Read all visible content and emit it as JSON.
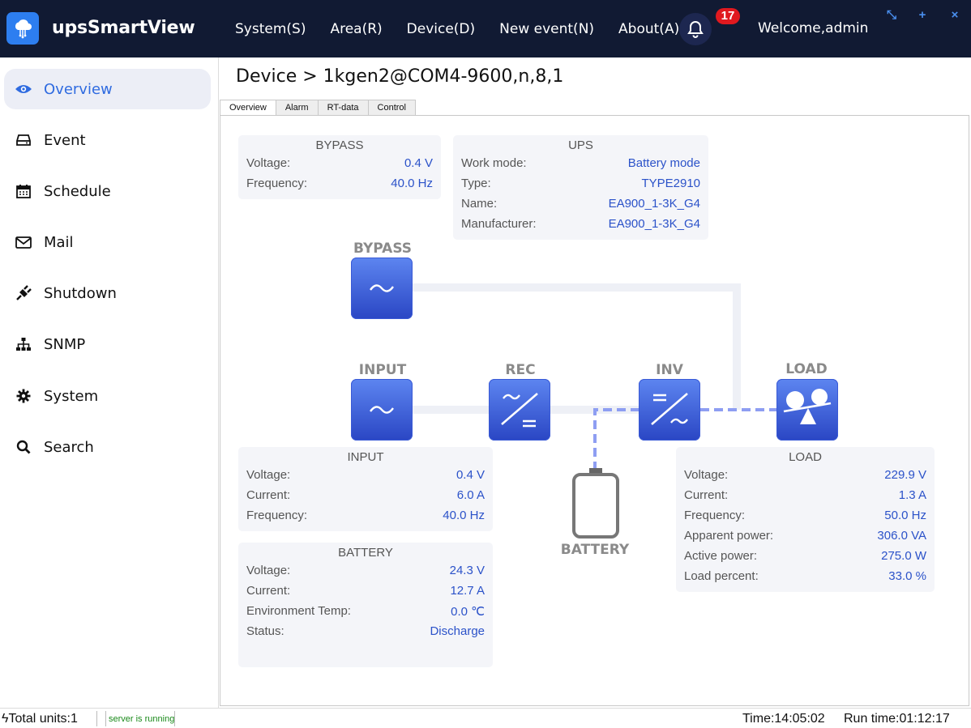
{
  "app": {
    "title": "upsSmartView"
  },
  "menu": [
    {
      "label": "System(S)"
    },
    {
      "label": "Area(R)"
    },
    {
      "label": "Device(D)"
    },
    {
      "label": "New event(N)"
    },
    {
      "label": "About(A)"
    }
  ],
  "header": {
    "notification_count": "17",
    "welcome": "Welcome,admin"
  },
  "sidebar": {
    "items": [
      {
        "label": "Overview",
        "icon": "eye-icon"
      },
      {
        "label": "Event",
        "icon": "drive-icon"
      },
      {
        "label": "Schedule",
        "icon": "calendar-icon"
      },
      {
        "label": "Mail",
        "icon": "mail-icon"
      },
      {
        "label": "Shutdown",
        "icon": "plug-icon"
      },
      {
        "label": "SNMP",
        "icon": "network-icon"
      },
      {
        "label": "System",
        "icon": "gear-icon"
      },
      {
        "label": "Search",
        "icon": "search-icon"
      }
    ]
  },
  "breadcrumb": "Device > 1kgen2@COM4-9600,n,8,1",
  "tabs": [
    {
      "label": "Overview"
    },
    {
      "label": "Alarm"
    },
    {
      "label": "RT-data"
    },
    {
      "label": "Control"
    }
  ],
  "panels": {
    "bypass": {
      "title": "BYPASS",
      "rows": [
        {
          "label": "Voltage:",
          "value": "0.4  V"
        },
        {
          "label": "Frequency:",
          "value": "40.0 Hz"
        }
      ]
    },
    "ups": {
      "title": "UPS",
      "rows": [
        {
          "label": "Work mode:",
          "value": "Battery mode"
        },
        {
          "label": "Type:",
          "value": "TYPE2910"
        },
        {
          "label": "Name:",
          "value": "EA900_1-3K_G4"
        },
        {
          "label": "Manufacturer:",
          "value": "EA900_1-3K_G4"
        }
      ]
    },
    "input": {
      "title": "INPUT",
      "rows": [
        {
          "label": "Voltage:",
          "value": "0.4 V"
        },
        {
          "label": "Current:",
          "value": "6.0 A"
        },
        {
          "label": "Frequency:",
          "value": "40.0 Hz"
        }
      ]
    },
    "battery": {
      "title": "BATTERY",
      "rows": [
        {
          "label": "Voltage:",
          "value": "24.3 V"
        },
        {
          "label": "Current:",
          "value": "12.7 A"
        },
        {
          "label": "Environment Temp:",
          "value": "0.0 ℃"
        },
        {
          "label": "Status:",
          "value": "Discharge"
        }
      ]
    },
    "load": {
      "title": "LOAD",
      "rows": [
        {
          "label": "Voltage:",
          "value": "229.9 V"
        },
        {
          "label": "Current:",
          "value": "1.3 A"
        },
        {
          "label": "Frequency:",
          "value": "50.0 Hz"
        },
        {
          "label": "Apparent power:",
          "value": "306.0 VA"
        },
        {
          "label": "Active power:",
          "value": "275.0 W"
        },
        {
          "label": "Load percent:",
          "value": "33.0 %"
        }
      ]
    }
  },
  "diagram": {
    "bypass": "BYPASS",
    "input": "INPUT",
    "rec": "REC",
    "inv": "INV",
    "load": "LOAD",
    "battery": "BATTERY"
  },
  "colors": {
    "header": "#111a33",
    "accent": "#2f6be0",
    "node": "#3a5ad6",
    "flow": "#8e9ef2"
  },
  "status": {
    "total_units": "Total units:1",
    "server": "server is running",
    "time": "Time:14:05:02",
    "run_time": "Run time:01:12:17"
  }
}
